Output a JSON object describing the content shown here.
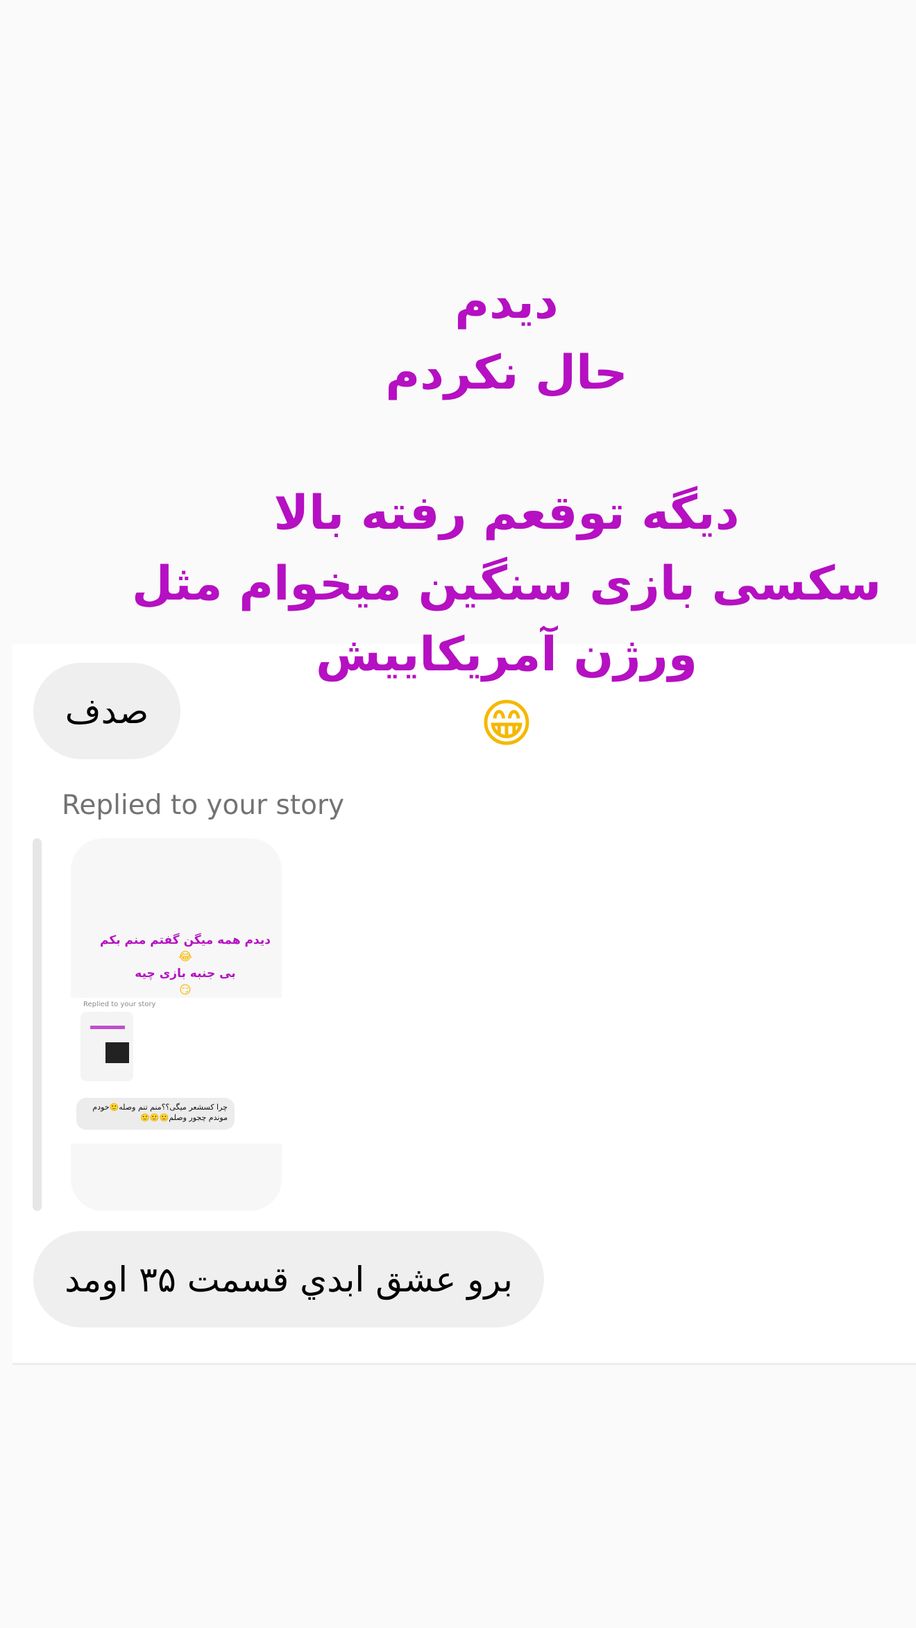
{
  "story_overlay": {
    "lines": [
      "دیدم",
      "حال نکردم",
      "دیگه توقعم رفته بالا",
      "سکسی بازی سنگین میخوام مثل",
      "ورژن آمریکاییش"
    ],
    "emoji": "😁",
    "color": "#b510c2"
  },
  "messages": {
    "first_bubble": "صدف",
    "replied_label": "Replied to your story",
    "last_bubble": "برو عشق ابدي قسمت ۳۵ اومد"
  },
  "story_thumbnail": {
    "line1": "دیدم همه میگن گفتم منم بکم",
    "emoji1": "😂",
    "line2": "بی جنبه بازی چیه",
    "emoji2": "😏",
    "replied_label": "Replied to your story",
    "bubble_line1": "چرا کسشعر میگی؟؟منم تنم وصله🙂خودم",
    "bubble_line2": "موندم چجور وصلم🙂🙂🙂"
  }
}
